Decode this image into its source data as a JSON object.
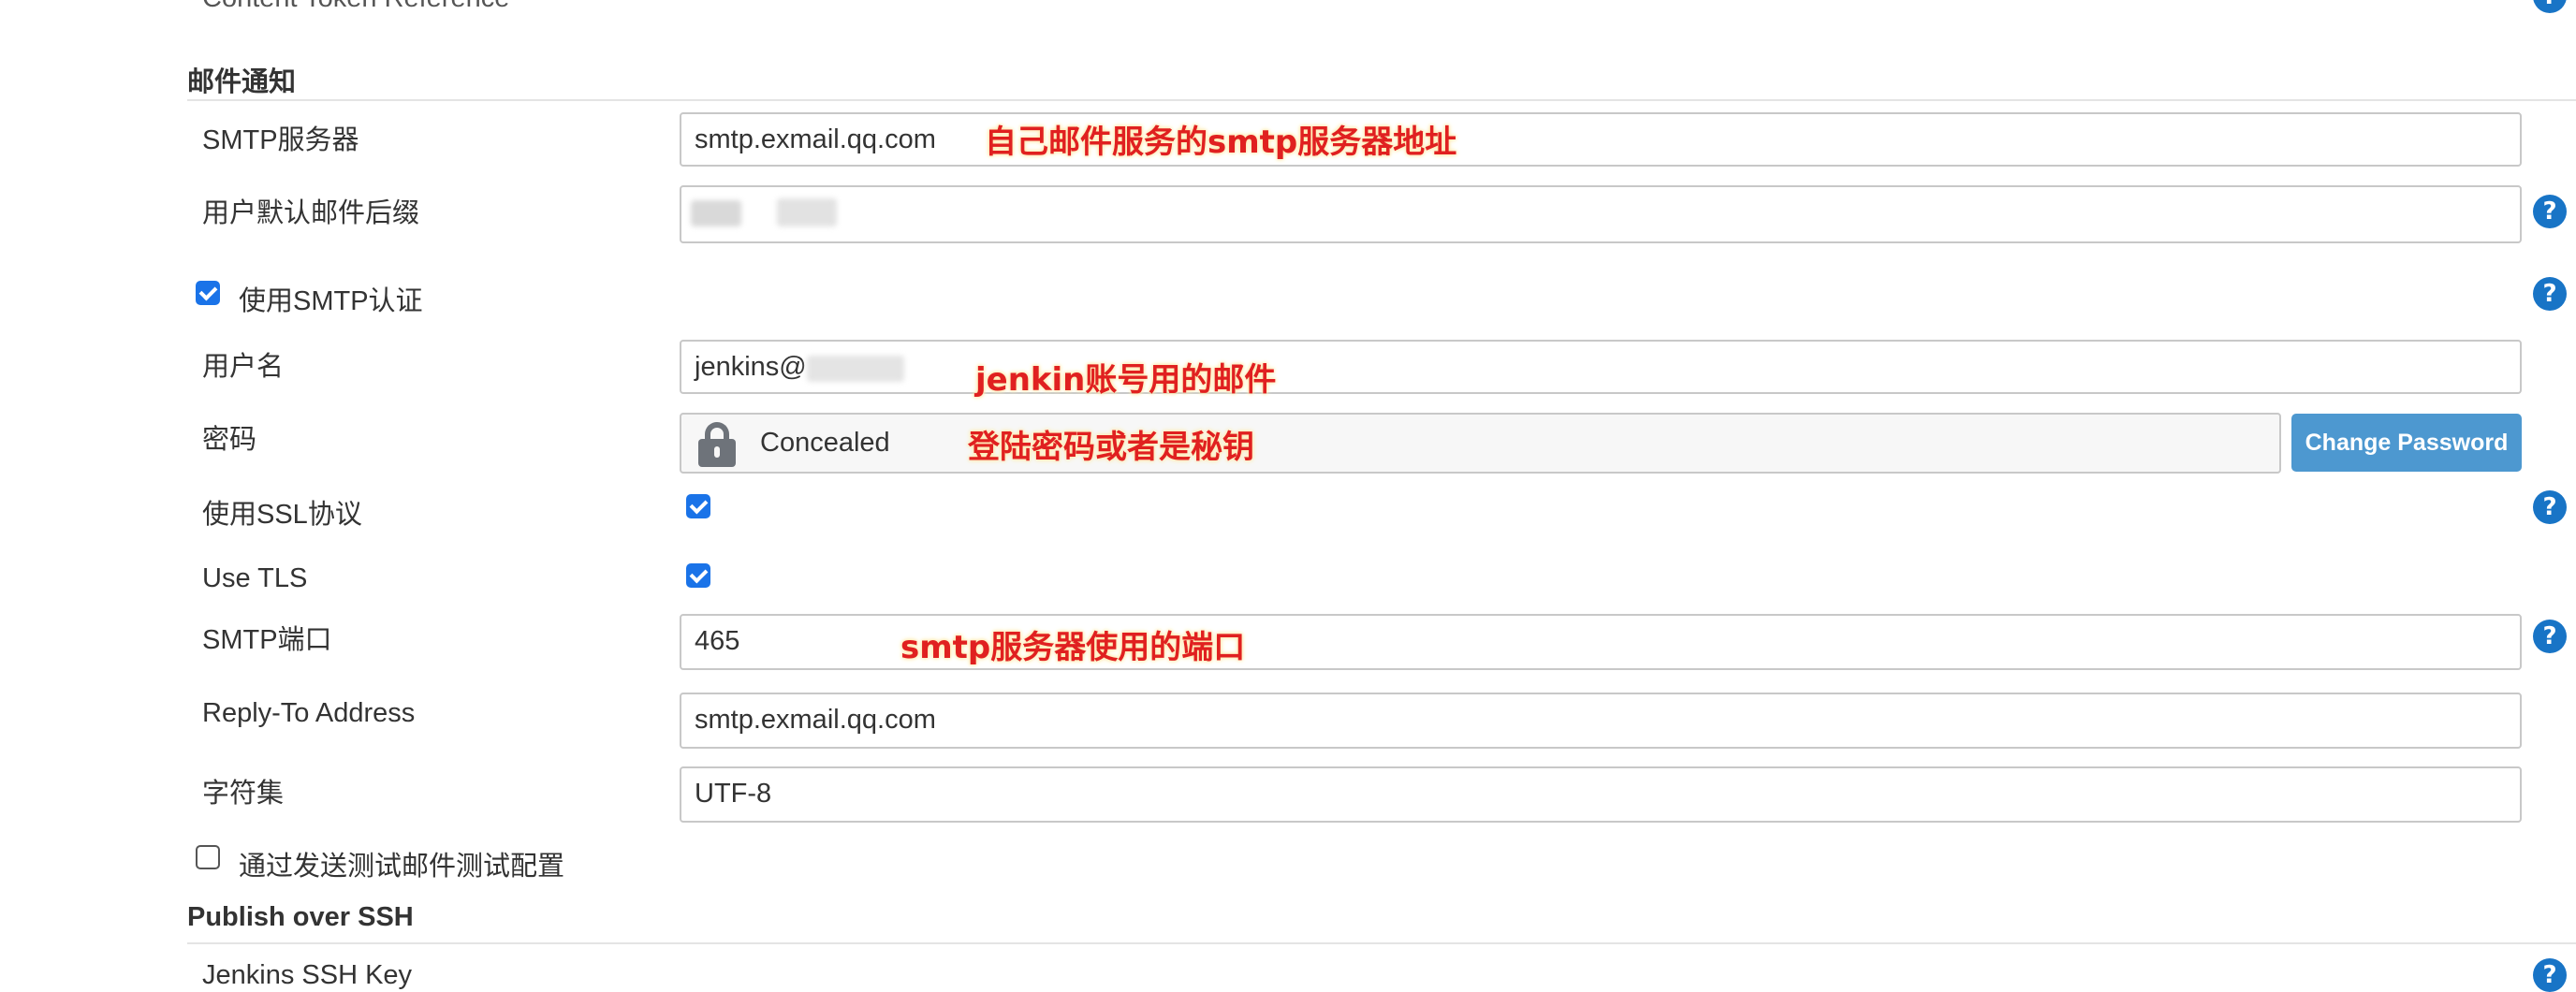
{
  "top_partial_label": "Content Token Reference",
  "mail_section": {
    "title": "邮件通知",
    "smtp_server": {
      "label": "SMTP服务器",
      "value": "smtp.exmail.qq.com",
      "annotation": "自己邮件服务的smtp服务器地址"
    },
    "default_suffix": {
      "label": "用户默认邮件后缀",
      "value": ""
    },
    "use_smtp_auth": {
      "label": "使用SMTP认证",
      "checked": true
    },
    "username": {
      "label": "用户名",
      "value": "jenkins@",
      "annotation": "jenkin账号用的邮件"
    },
    "password": {
      "label": "密码",
      "value": "Concealed",
      "button": "Change Password",
      "annotation": "登陆密码或者是秘钥"
    },
    "use_ssl": {
      "label": "使用SSL协议",
      "checked": true
    },
    "use_tls": {
      "label": "Use TLS",
      "checked": true
    },
    "smtp_port": {
      "label": "SMTP端口",
      "value": "465",
      "annotation": "smtp服务器使用的端口"
    },
    "reply_to": {
      "label": "Reply-To Address",
      "value": "smtp.exmail.qq.com"
    },
    "charset": {
      "label": "字符集",
      "value": "UTF-8"
    },
    "test_config": {
      "label": "通过发送测试邮件测试配置",
      "checked": false
    }
  },
  "ssh_section": {
    "title": "Publish over SSH",
    "ssh_key": {
      "label": "Jenkins SSH Key"
    }
  },
  "help_icon_glyph": "?",
  "colors": {
    "accent": "#1874c6",
    "annotation": "#e02020",
    "button": "#4d98d0"
  }
}
